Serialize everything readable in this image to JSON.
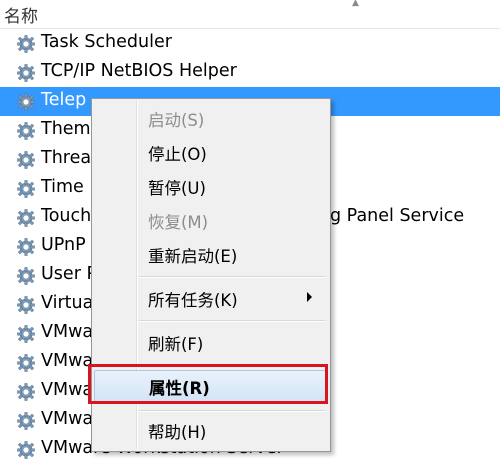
{
  "header": {
    "column_name": "名称",
    "sort_icon": "chevron-up-icon"
  },
  "services": [
    {
      "name": "Task Scheduler"
    },
    {
      "name": "TCP/IP NetBIOS Helper"
    },
    {
      "name": "Telep",
      "selected": true
    },
    {
      "name": "Theme"
    },
    {
      "name": "Threa"
    },
    {
      "name": "Time I"
    },
    {
      "name": "Touch",
      "suffix": "g Panel Service"
    },
    {
      "name": "UPnP"
    },
    {
      "name": "User P"
    },
    {
      "name": "Virtua"
    },
    {
      "name": "VMwa"
    },
    {
      "name": "VMwa"
    },
    {
      "name": "VMwa"
    },
    {
      "name": "VMwa"
    },
    {
      "name": "VMware Workstation Server"
    }
  ],
  "context_menu": {
    "items": [
      {
        "label": "启动(S)",
        "disabled": true
      },
      {
        "label": "停止(O)"
      },
      {
        "label": "暂停(U)"
      },
      {
        "label": "恢复(M)",
        "disabled": true
      },
      {
        "label": "重新启动(E)"
      },
      {
        "label": "所有任务(K)",
        "submenu": true
      },
      {
        "label": "刷新(F)"
      },
      {
        "label": "属性(R)",
        "highlighted": true
      },
      {
        "label": "帮助(H)"
      }
    ]
  },
  "colors": {
    "selection": "#3399ff",
    "menu_bg": "#f0f0f0",
    "highlight_border": "#d9141e"
  }
}
